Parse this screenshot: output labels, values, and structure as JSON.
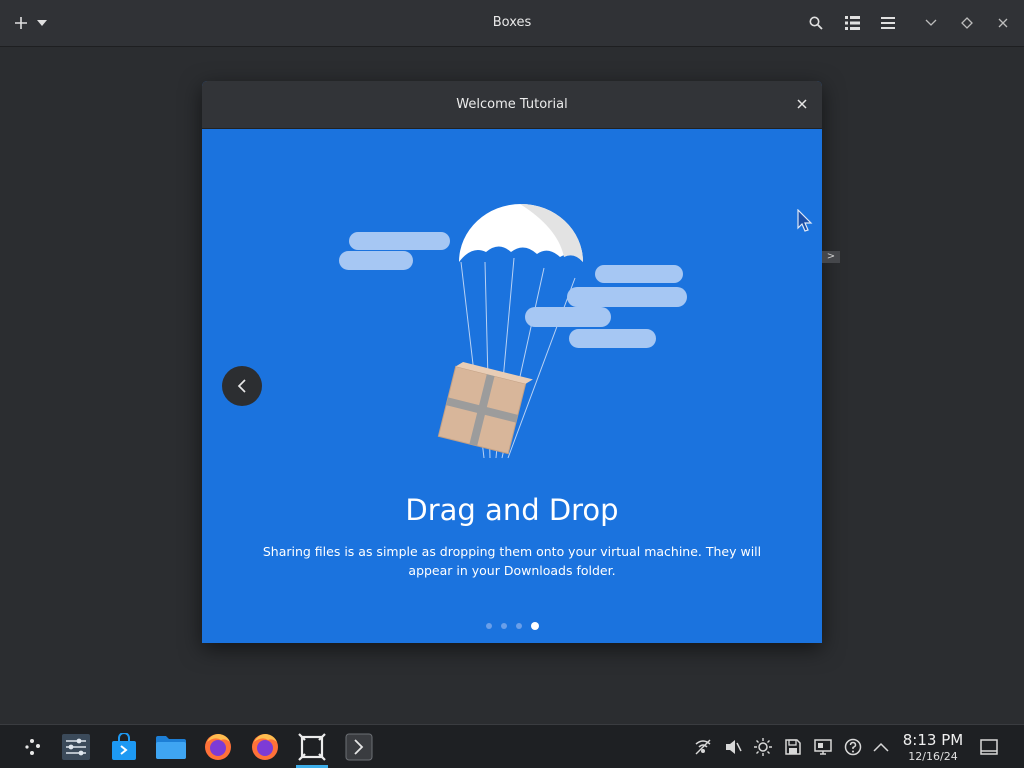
{
  "app": {
    "title": "Boxes"
  },
  "dialog": {
    "title": "Welcome Tutorial"
  },
  "slide": {
    "title": "Drag and Drop",
    "description": "Sharing files is as simple as dropping them onto your virtual machine. They will appear in your Downloads folder.",
    "page_count": 4,
    "current_page": 4
  },
  "colors": {
    "slide_bg": "#1b73de",
    "headerbar_bg": "#303236",
    "window_bg": "#2b2d30",
    "taskbar_bg": "#1e2023"
  },
  "header_icons": [
    "add-icon",
    "dropdown-icon",
    "search-icon",
    "list-view-icon",
    "menu-icon",
    "minimize-icon",
    "maximize-icon",
    "close-icon"
  ],
  "taskbar": {
    "apps": [
      "launcher-icon",
      "system-settings-icon",
      "discover-store-icon",
      "file-manager-icon",
      "firefox-icon",
      "firefox-icon",
      "boxes-icon",
      "terminal-icon"
    ],
    "tray": [
      "network-icon",
      "volume-muted-icon",
      "brightness-icon",
      "storage-icon",
      "display-icon",
      "help-icon",
      "expand-tray-icon"
    ],
    "time": "8:13 PM",
    "date": "12/16/24"
  }
}
